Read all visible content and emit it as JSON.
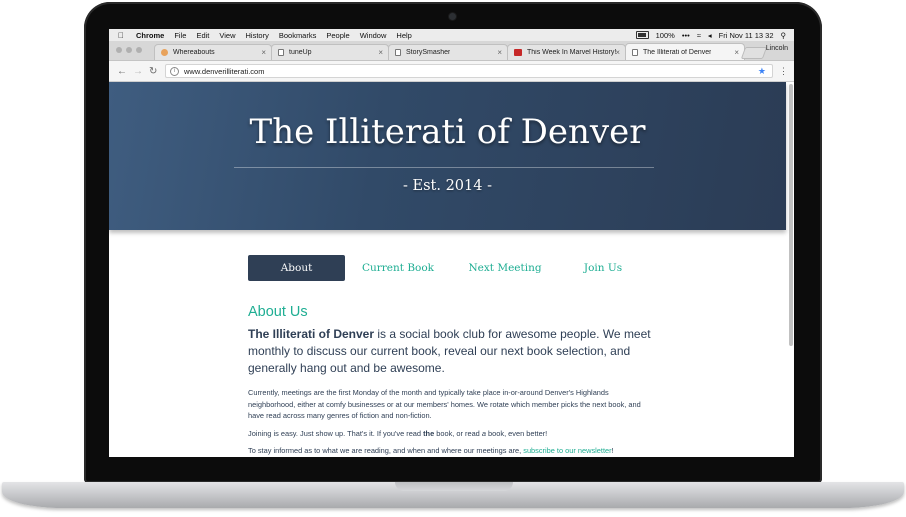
{
  "menubar": {
    "app": "Chrome",
    "menus": [
      "File",
      "Edit",
      "View",
      "History",
      "Bookmarks",
      "People",
      "Window",
      "Help"
    ],
    "battery": "100%",
    "clock": "Fri Nov 11  13 32"
  },
  "tabs": [
    {
      "label": "Whereabouts",
      "icon": "orange-favicon"
    },
    {
      "label": "tuneUp",
      "icon": "page-icon"
    },
    {
      "label": "StorySmasher",
      "icon": "page-icon"
    },
    {
      "label": "This Week In Marvel History!",
      "icon": "marvel-favicon"
    },
    {
      "label": "The Illiterati of Denver",
      "icon": "page-icon",
      "active": true
    }
  ],
  "profile_name": "Lincoln",
  "address": "www.denverilliterati.com",
  "site": {
    "title": "The Illiterati of Denver",
    "established": "- Est. 2014 -",
    "nav": [
      "About",
      "Current Book",
      "Next Meeting",
      "Join Us"
    ],
    "section_heading": "About Us",
    "lead_name": "The Illiterati of Denver",
    "lead_text": " is a social book club for awesome people. We meet monthly to discuss our current book, reveal our next book selection, and generally hang out and be awesome.",
    "para1": "Currently, meetings are the first Monday of the month and typically take place in-or-around Denver's Highlands neighborhood, either at comfy businesses or at our members' homes. We rotate which member picks the next book, and have read across many genres of fiction and non-fiction.",
    "para2_a": "Joining is easy. Just show up. That's it. If you've read ",
    "para2_the": "the",
    "para2_b": " book, or read ",
    "para2_a_word": "a",
    "para2_c": " book, even better!",
    "para3_a": "To stay informed as to what we are reading, and when and where our meetings are, ",
    "para3_link": "subscribe to our newsletter",
    "para3_b": "!"
  },
  "colors": {
    "accent": "#1fae93",
    "nav_active_bg": "#2f3f55",
    "hero_bg": "#34506f"
  }
}
